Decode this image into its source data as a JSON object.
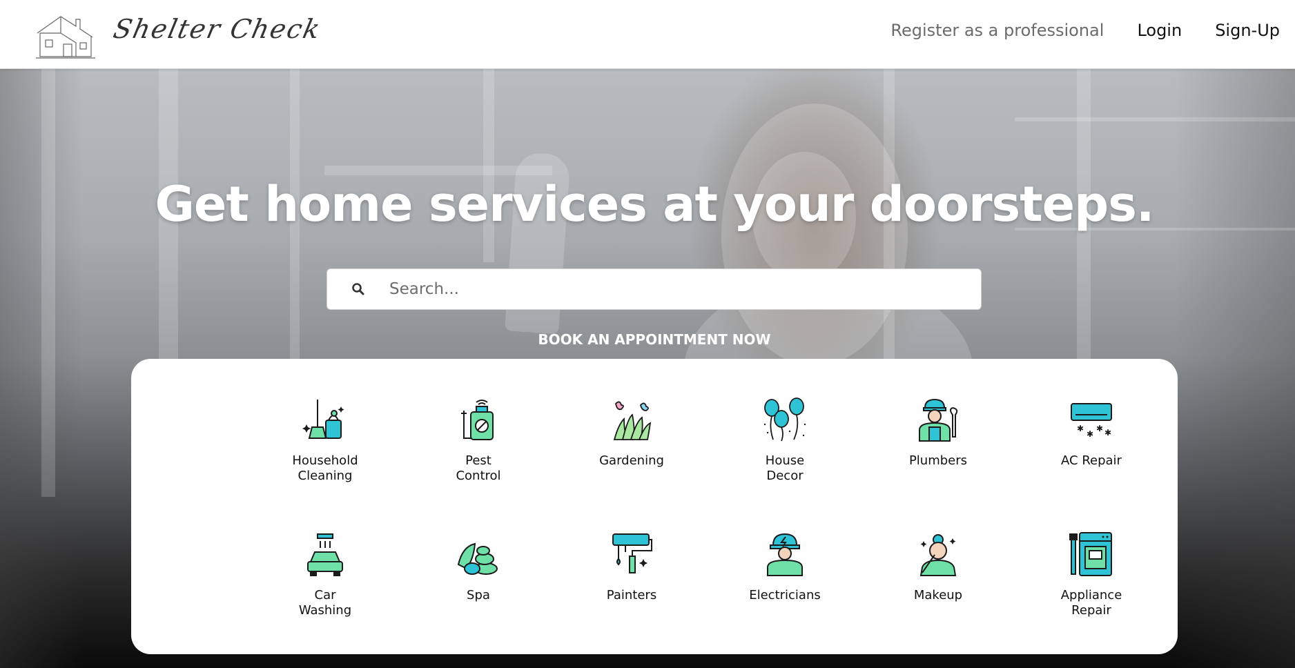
{
  "header": {
    "brand": "Shelter Check",
    "logo_icon": "house-sketch-icon",
    "nav": {
      "register": "Register as a professional",
      "login": "Login",
      "signup": "Sign-Up"
    }
  },
  "hero": {
    "title": "Get home services at your doorsteps.",
    "search": {
      "placeholder": "Search...",
      "icon": "search-icon"
    },
    "cta": "BOOK AN APPOINTMENT NOW"
  },
  "services": [
    {
      "label": "Household\nCleaning",
      "icon": "cleaning-icon"
    },
    {
      "label": "Pest\nControl",
      "icon": "pest-control-icon"
    },
    {
      "label": "Gardening",
      "icon": "gardening-icon"
    },
    {
      "label": "House\nDecor",
      "icon": "balloons-icon"
    },
    {
      "label": "Plumbers",
      "icon": "plumber-icon"
    },
    {
      "label": "AC Repair",
      "icon": "air-conditioner-icon"
    },
    {
      "label": "Car\nWashing",
      "icon": "car-wash-icon"
    },
    {
      "label": "Spa",
      "icon": "spa-stones-icon"
    },
    {
      "label": "Painters",
      "icon": "paint-roller-icon"
    },
    {
      "label": "Electricians",
      "icon": "electrician-icon"
    },
    {
      "label": "Makeup",
      "icon": "makeup-icon"
    },
    {
      "label": "Appliance\nRepair",
      "icon": "appliance-icon"
    }
  ],
  "colors": {
    "icon_teal": "#2ec4d6",
    "icon_green": "#6fe0a8",
    "outline": "#1a1a1a"
  }
}
